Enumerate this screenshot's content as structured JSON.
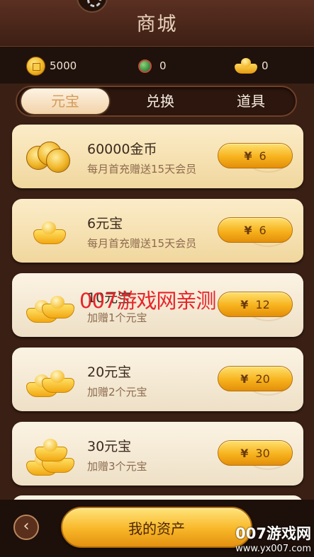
{
  "header": {
    "title": "商城"
  },
  "wallet": {
    "coins": {
      "icon": "gold-coin-icon",
      "value": "5000"
    },
    "jade": {
      "icon": "jade-icon",
      "value": "0"
    },
    "ingots": {
      "icon": "gold-ingot-icon",
      "value": "0"
    }
  },
  "tabs": [
    {
      "label": "元宝",
      "active": true
    },
    {
      "label": "兑换",
      "active": false
    },
    {
      "label": "道具",
      "active": false
    }
  ],
  "items": [
    {
      "name": "60000金币",
      "sub": "每月首充赠送15天会员",
      "currency": "¥",
      "price": "6",
      "icon": "coin-pile-icon"
    },
    {
      "name": "6元宝",
      "sub": "每月首充赠送15天会员",
      "currency": "¥",
      "price": "6",
      "icon": "gold-ingot-icon"
    },
    {
      "name": "10元宝",
      "sub": "加赠1个元宝",
      "currency": "¥",
      "price": "12",
      "icon": "double-ingot-icon"
    },
    {
      "name": "20元宝",
      "sub": "加赠2个元宝",
      "currency": "¥",
      "price": "20",
      "icon": "double-ingot-icon"
    },
    {
      "name": "30元宝",
      "sub": "加赠3个元宝",
      "currency": "¥",
      "price": "30",
      "icon": "ingot-stack-icon"
    }
  ],
  "watermark": "007游戏网亲测",
  "footer": {
    "back_icon": "back-arrow-icon",
    "assets_label": "我的资产"
  },
  "corner_logo": {
    "title": "007游戏网",
    "url": "www.yx007.com"
  }
}
